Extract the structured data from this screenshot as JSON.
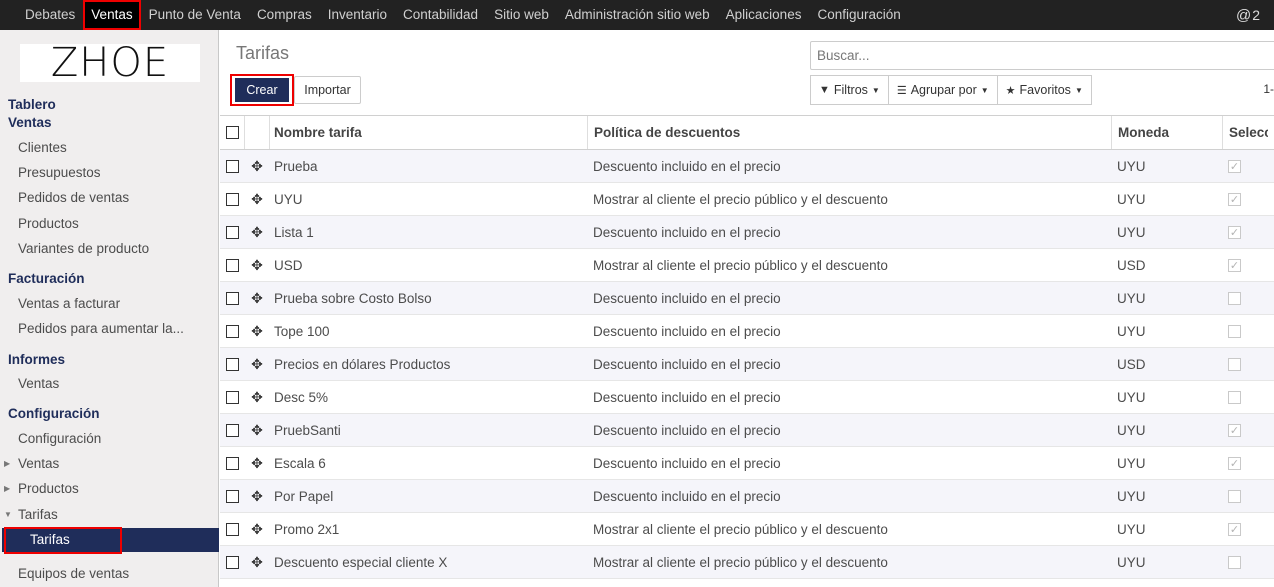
{
  "topbar": {
    "menu": [
      "Debates",
      "Ventas",
      "Punto de Venta",
      "Compras",
      "Inventario",
      "Contabilidad",
      "Sitio web",
      "Administración sitio web",
      "Aplicaciones",
      "Configuración"
    ],
    "active": "Ventas",
    "notification_count": "2"
  },
  "sidebar": {
    "logo_text": "ZHOE",
    "tablero": "Tablero",
    "ventas_head": "Ventas",
    "ventas_items": [
      "Clientes",
      "Presupuestos",
      "Pedidos de ventas",
      "Productos",
      "Variantes de producto"
    ],
    "facturacion_head": "Facturación",
    "facturacion_items": [
      "Ventas a facturar",
      "Pedidos para aumentar la..."
    ],
    "informes_head": "Informes",
    "informes_items": [
      "Ventas"
    ],
    "config_head": "Configuración",
    "config_item": "Configuración",
    "tree_ventas": "Ventas",
    "tree_productos": "Productos",
    "tree_tarifas": "Tarifas",
    "active_item": "Tarifas",
    "equipos": "Equipos de ventas"
  },
  "main": {
    "title": "Tarifas",
    "search_placeholder": "Buscar...",
    "create_label": "Crear",
    "import_label": "Importar",
    "filters_label": "Filtros",
    "group_label": "Agrupar por",
    "favorites_label": "Favoritos",
    "pager": "1-"
  },
  "table": {
    "columns": [
      "Nombre tarifa",
      "Política de descuentos",
      "Moneda",
      "Selecci"
    ],
    "rows": [
      {
        "name": "Prueba",
        "policy": "Descuento incluido en el precio",
        "currency": "UYU",
        "selectable": true
      },
      {
        "name": "UYU",
        "policy": "Mostrar al cliente el precio público y el descuento",
        "currency": "UYU",
        "selectable": true
      },
      {
        "name": "Lista 1",
        "policy": "Descuento incluido en el precio",
        "currency": "UYU",
        "selectable": true
      },
      {
        "name": "USD",
        "policy": "Mostrar al cliente el precio público y el descuento",
        "currency": "USD",
        "selectable": true
      },
      {
        "name": "Prueba sobre Costo Bolso",
        "policy": "Descuento incluido en el precio",
        "currency": "UYU",
        "selectable": false
      },
      {
        "name": "Tope 100",
        "policy": "Descuento incluido en el precio",
        "currency": "UYU",
        "selectable": false
      },
      {
        "name": "Precios en dólares Productos",
        "policy": "Descuento incluido en el precio",
        "currency": "USD",
        "selectable": false
      },
      {
        "name": "Desc 5%",
        "policy": "Descuento incluido en el precio",
        "currency": "UYU",
        "selectable": false
      },
      {
        "name": "PruebSanti",
        "policy": "Descuento incluido en el precio",
        "currency": "UYU",
        "selectable": true
      },
      {
        "name": "Escala 6",
        "policy": "Descuento incluido en el precio",
        "currency": "UYU",
        "selectable": true
      },
      {
        "name": "Por Papel",
        "policy": "Descuento incluido en el precio",
        "currency": "UYU",
        "selectable": false
      },
      {
        "name": "Promo 2x1",
        "policy": "Mostrar al cliente el precio público y el descuento",
        "currency": "UYU",
        "selectable": true
      },
      {
        "name": "Descuento especial cliente X",
        "policy": "Mostrar al cliente el precio público y el descuento",
        "currency": "UYU",
        "selectable": false
      }
    ]
  }
}
